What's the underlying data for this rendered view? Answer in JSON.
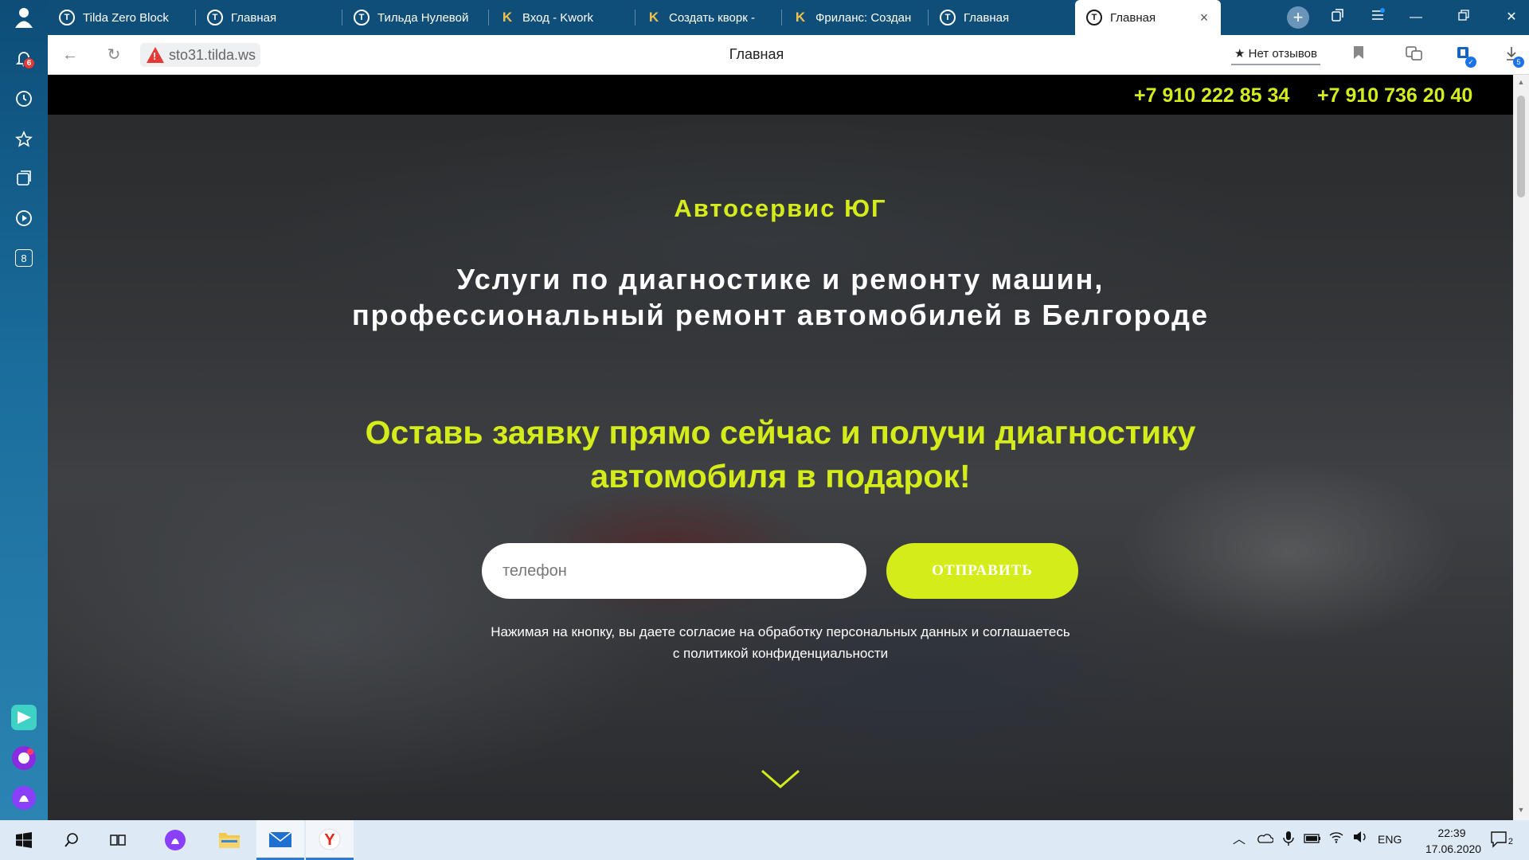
{
  "sidebar": {
    "notifications_count": "6",
    "items": [
      "account-icon",
      "notifications-icon",
      "history-icon",
      "favorites-icon",
      "collections-icon",
      "video-icon",
      "counter-badge-icon"
    ],
    "counter_label": "8",
    "apps": [
      "zen-app-icon",
      "alice-music-icon",
      "alice-icon"
    ]
  },
  "tabs": [
    {
      "label": "Tilda Zero Block",
      "icon": "tilda-icon"
    },
    {
      "label": "Главная",
      "icon": "tilda-icon"
    },
    {
      "label": "Тильда Нулевой",
      "icon": "tilda-icon"
    },
    {
      "label": "Вход - Kwork",
      "icon": "kwork-icon"
    },
    {
      "label": "Создать кворк - ",
      "icon": "kwork-icon"
    },
    {
      "label": "Фриланс: Создан",
      "icon": "kwork-icon"
    },
    {
      "label": "Главная",
      "icon": "tilda-icon"
    },
    {
      "label": "Главная",
      "icon": "tilda-icon",
      "active": true
    }
  ],
  "address_bar": {
    "url": "sto31.tilda.ws",
    "page_title": "Главная",
    "reviews_label": "★ Нет отзывов",
    "downloads_count": "5"
  },
  "page": {
    "phones": [
      "+7 910 222 85 34",
      "+7 910 736 20 40"
    ],
    "brand": "Автосервис ЮГ",
    "headline_line1": "Услуги по диагностике и ремонту машин,",
    "headline_line2": "профессиональный ремонт автомобилей в Белгороде",
    "offer_line1": "Оставь заявку прямо сейчас и получи диагностику",
    "offer_line2": "автомобиля в подарок!",
    "form": {
      "phone_placeholder": "телефон",
      "phone_value": "",
      "submit_label": "ОТПРАВИТЬ"
    },
    "consent_line1": "Нажимая на кнопку, вы даете согласие на обработку персональных данных и соглашаетесь",
    "consent_line2": "с политикой конфиденциальности",
    "colors": {
      "accent": "#d4ec1a",
      "phone_bar": "#000000",
      "text": "#ffffff"
    }
  },
  "taskbar": {
    "apps": [
      "start-icon",
      "search-icon",
      "task-view-icon",
      "alice-icon",
      "file-explorer-icon",
      "mail-icon",
      "yandex-browser-icon"
    ],
    "language": "ENG",
    "time": "22:39",
    "date": "17.06.2020",
    "notification_count": "2"
  }
}
